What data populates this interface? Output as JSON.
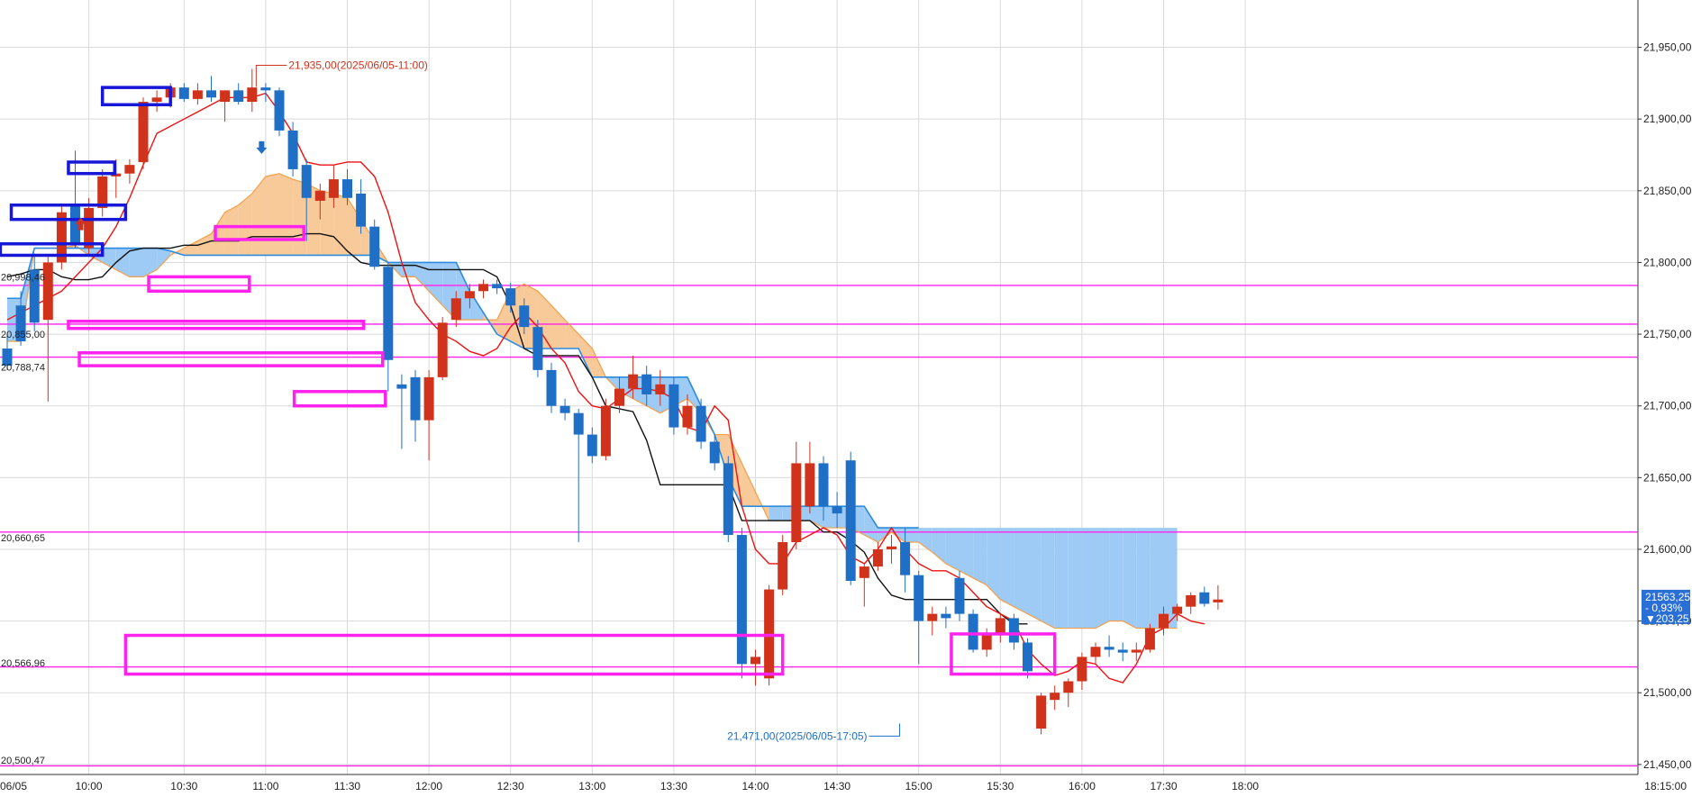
{
  "colors": {
    "grid": "#d9d9d9",
    "up": "#d1321b",
    "down": "#1f6fc6",
    "tenkan": "#ee1111",
    "kijun": "#111111",
    "span_line": "#2d8bdf",
    "cloud_blue": "#9ecbf5",
    "cloud_orange": "#f8c999",
    "span_orange_line": "#f2a04a",
    "magenta": "#ff22ee",
    "blue_box": "#1717d9",
    "price_badge": "#2a6fd6"
  },
  "chart_data": {
    "type": "candlestick",
    "title": "",
    "xlabel": "",
    "ylabel": "",
    "ylim": [
      21443,
      21983
    ],
    "y_ticks": [
      "21,450,00",
      "21,500,00",
      "21,550,00",
      "21,600,00",
      "21,650,00",
      "21,700,00",
      "21,750,00",
      "21,800,00",
      "21,850,00",
      "21,900,00",
      "21,950,00"
    ],
    "y_tick_values": [
      21450,
      21500,
      21550,
      21600,
      21650,
      21700,
      21750,
      21800,
      21850,
      21900,
      21950
    ],
    "x_ticks": [
      "06/05",
      "10:00",
      "10:30",
      "11:00",
      "11:30",
      "12:00",
      "12:30",
      "13:00",
      "13:30",
      "14:00",
      "14:30",
      "15:00",
      "15:30",
      "16:00",
      "17:30",
      "18:00",
      "18:15:00"
    ],
    "x_tick_bar_index": [
      0,
      6,
      13,
      19,
      25,
      31,
      37,
      43,
      49,
      55,
      61,
      67,
      73,
      79,
      85,
      91,
      121
    ],
    "candles": [
      {
        "o": 21740,
        "h": 21750,
        "l": 21725,
        "c": 21728
      },
      {
        "o": 21770,
        "h": 21780,
        "l": 21742,
        "c": 21745
      },
      {
        "o": 21795,
        "h": 21805,
        "l": 21752,
        "c": 21758
      },
      {
        "o": 21760,
        "h": 21805,
        "l": 21703,
        "c": 21800
      },
      {
        "o": 21800,
        "h": 21840,
        "l": 21795,
        "c": 21835
      },
      {
        "o": 21840,
        "h": 21878,
        "l": 21810,
        "c": 21812
      },
      {
        "o": 21810,
        "h": 21845,
        "l": 21806,
        "c": 21838
      },
      {
        "o": 21838,
        "h": 21865,
        "l": 21832,
        "c": 21860
      },
      {
        "o": 21860,
        "h": 21872,
        "l": 21845,
        "c": 21862
      },
      {
        "o": 21862,
        "h": 21872,
        "l": 21855,
        "c": 21868
      },
      {
        "o": 21870,
        "h": 21915,
        "l": 21865,
        "c": 21912
      },
      {
        "o": 21912,
        "h": 21920,
        "l": 21905,
        "c": 21915
      },
      {
        "o": 21915,
        "h": 21925,
        "l": 21908,
        "c": 21922
      },
      {
        "o": 21922,
        "h": 21925,
        "l": 21912,
        "c": 21914
      },
      {
        "o": 21914,
        "h": 21925,
        "l": 21910,
        "c": 21920
      },
      {
        "o": 21920,
        "h": 21930,
        "l": 21912,
        "c": 21915
      },
      {
        "o": 21912,
        "h": 21920,
        "l": 21898,
        "c": 21920
      },
      {
        "o": 21920,
        "h": 21925,
        "l": 21910,
        "c": 21912
      },
      {
        "o": 21912,
        "h": 21935,
        "l": 21905,
        "c": 21922
      },
      {
        "o": 21922,
        "h": 21925,
        "l": 21912,
        "c": 21920
      },
      {
        "o": 21920,
        "h": 21922,
        "l": 21888,
        "c": 21892
      },
      {
        "o": 21892,
        "h": 21898,
        "l": 21860,
        "c": 21865
      },
      {
        "o": 21868,
        "h": 21872,
        "l": 21815,
        "c": 21845
      },
      {
        "o": 21843,
        "h": 21855,
        "l": 21830,
        "c": 21850
      },
      {
        "o": 21845,
        "h": 21868,
        "l": 21838,
        "c": 21858
      },
      {
        "o": 21858,
        "h": 21865,
        "l": 21840,
        "c": 21845
      },
      {
        "o": 21848,
        "h": 21858,
        "l": 21820,
        "c": 21825
      },
      {
        "o": 21825,
        "h": 21830,
        "l": 21795,
        "c": 21797
      },
      {
        "o": 21797,
        "h": 21800,
        "l": 21710,
        "c": 21732
      },
      {
        "o": 21715,
        "h": 21722,
        "l": 21670,
        "c": 21712
      },
      {
        "o": 21720,
        "h": 21725,
        "l": 21675,
        "c": 21690
      },
      {
        "o": 21690,
        "h": 21725,
        "l": 21662,
        "c": 21720
      },
      {
        "o": 21720,
        "h": 21762,
        "l": 21718,
        "c": 21758
      },
      {
        "o": 21760,
        "h": 21780,
        "l": 21755,
        "c": 21775
      },
      {
        "o": 21775,
        "h": 21785,
        "l": 21768,
        "c": 21780
      },
      {
        "o": 21780,
        "h": 21788,
        "l": 21775,
        "c": 21785
      },
      {
        "o": 21785,
        "h": 21788,
        "l": 21778,
        "c": 21782
      },
      {
        "o": 21782,
        "h": 21786,
        "l": 21765,
        "c": 21770
      },
      {
        "o": 21770,
        "h": 21775,
        "l": 21750,
        "c": 21755
      },
      {
        "o": 21755,
        "h": 21760,
        "l": 21720,
        "c": 21725
      },
      {
        "o": 21725,
        "h": 21730,
        "l": 21695,
        "c": 21700
      },
      {
        "o": 21700,
        "h": 21705,
        "l": 21690,
        "c": 21695
      },
      {
        "o": 21695,
        "h": 21698,
        "l": 21605,
        "c": 21680
      },
      {
        "o": 21680,
        "h": 21685,
        "l": 21660,
        "c": 21665
      },
      {
        "o": 21665,
        "h": 21705,
        "l": 21662,
        "c": 21700
      },
      {
        "o": 21700,
        "h": 21720,
        "l": 21695,
        "c": 21712
      },
      {
        "o": 21712,
        "h": 21735,
        "l": 21705,
        "c": 21722
      },
      {
        "o": 21722,
        "h": 21728,
        "l": 21700,
        "c": 21708
      },
      {
        "o": 21708,
        "h": 21725,
        "l": 21700,
        "c": 21715
      },
      {
        "o": 21715,
        "h": 21720,
        "l": 21680,
        "c": 21685
      },
      {
        "o": 21685,
        "h": 21708,
        "l": 21680,
        "c": 21700
      },
      {
        "o": 21700,
        "h": 21705,
        "l": 21670,
        "c": 21675
      },
      {
        "o": 21675,
        "h": 21680,
        "l": 21655,
        "c": 21660
      },
      {
        "o": 21660,
        "h": 21665,
        "l": 21605,
        "c": 21610
      },
      {
        "o": 21610,
        "h": 21615,
        "l": 21510,
        "c": 21520
      },
      {
        "o": 21520,
        "h": 21530,
        "l": 21505,
        "c": 21525
      },
      {
        "o": 21510,
        "h": 21575,
        "l": 21505,
        "c": 21572
      },
      {
        "o": 21572,
        "h": 21610,
        "l": 21568,
        "c": 21605
      },
      {
        "o": 21605,
        "h": 21675,
        "l": 21600,
        "c": 21660
      },
      {
        "o": 21630,
        "h": 21675,
        "l": 21625,
        "c": 21660
      },
      {
        "o": 21660,
        "h": 21665,
        "l": 21620,
        "c": 21630
      },
      {
        "o": 21630,
        "h": 21640,
        "l": 21615,
        "c": 21625
      },
      {
        "o": 21662,
        "h": 21668,
        "l": 21575,
        "c": 21578
      },
      {
        "o": 21580,
        "h": 21590,
        "l": 21560,
        "c": 21588
      },
      {
        "o": 21588,
        "h": 21605,
        "l": 21585,
        "c": 21600
      },
      {
        "o": 21600,
        "h": 21610,
        "l": 21590,
        "c": 21602
      },
      {
        "o": 21605,
        "h": 21615,
        "l": 21570,
        "c": 21582
      },
      {
        "o": 21582,
        "h": 21585,
        "l": 21520,
        "c": 21550
      },
      {
        "o": 21550,
        "h": 21560,
        "l": 21540,
        "c": 21555
      },
      {
        "o": 21555,
        "h": 21560,
        "l": 21545,
        "c": 21552
      },
      {
        "o": 21580,
        "h": 21585,
        "l": 21550,
        "c": 21555
      },
      {
        "o": 21555,
        "h": 21558,
        "l": 21528,
        "c": 21530
      },
      {
        "o": 21530,
        "h": 21545,
        "l": 21525,
        "c": 21540
      },
      {
        "o": 21540,
        "h": 21555,
        "l": 21535,
        "c": 21552
      },
      {
        "o": 21552,
        "h": 21555,
        "l": 21530,
        "c": 21535
      },
      {
        "o": 21535,
        "h": 21538,
        "l": 21510,
        "c": 21515
      },
      {
        "o": 21475,
        "h": 21500,
        "l": 21471,
        "c": 21498
      },
      {
        "o": 21495,
        "h": 21505,
        "l": 21488,
        "c": 21500
      },
      {
        "o": 21500,
        "h": 21510,
        "l": 21490,
        "c": 21508
      },
      {
        "o": 21508,
        "h": 21528,
        "l": 21502,
        "c": 21525
      },
      {
        "o": 21525,
        "h": 21535,
        "l": 21520,
        "c": 21532
      },
      {
        "o": 21532,
        "h": 21540,
        "l": 21525,
        "c": 21530
      },
      {
        "o": 21530,
        "h": 21535,
        "l": 21522,
        "c": 21528
      },
      {
        "o": 21528,
        "h": 21535,
        "l": 21522,
        "c": 21530
      },
      {
        "o": 21530,
        "h": 21548,
        "l": 21528,
        "c": 21545
      },
      {
        "o": 21545,
        "h": 21560,
        "l": 21540,
        "c": 21555
      },
      {
        "o": 21555,
        "h": 21562,
        "l": 21550,
        "c": 21560
      },
      {
        "o": 21560,
        "h": 21570,
        "l": 21555,
        "c": 21568
      },
      {
        "o": 21570,
        "h": 21574,
        "l": 21560,
        "c": 21562
      },
      {
        "o": 21563,
        "h": 21575,
        "l": 21558,
        "c": 21565
      }
    ],
    "tenkan": [
      21760,
      21765,
      21770,
      21775,
      21780,
      21790,
      21800,
      21810,
      21825,
      21845,
      21868,
      21890,
      21895,
      21900,
      21905,
      21910,
      21915,
      21915,
      21915,
      21918,
      21905,
      21890,
      21870,
      21868,
      21868,
      21870,
      21870,
      21860,
      21835,
      21800,
      21772,
      21760,
      21750,
      21745,
      21738,
      21735,
      21740,
      21755,
      21765,
      21755,
      21740,
      21730,
      21710,
      21700,
      21698,
      21705,
      21712,
      21712,
      21710,
      21705,
      21685,
      21682,
      21700,
      21690,
      21630,
      21600,
      21590,
      21590,
      21605,
      21610,
      21615,
      21610,
      21595,
      21590,
      21600,
      21615,
      21600,
      21590,
      21585,
      21585,
      21580,
      21570,
      21560,
      21555,
      21550,
      21530,
      21520,
      21512,
      21515,
      21522,
      21520,
      21510,
      21507,
      21520,
      21540,
      21545,
      21555,
      21550,
      21548
    ],
    "kijun": [
      21790,
      21792,
      21795,
      21795,
      21790,
      21788,
      21788,
      21790,
      21800,
      21808,
      21810,
      21810,
      21810,
      21812,
      21812,
      21815,
      21815,
      21815,
      21818,
      21818,
      21818,
      21818,
      21820,
      21820,
      21818,
      21808,
      21800,
      21798,
      21798,
      21798,
      21798,
      21795,
      21795,
      21795,
      21795,
      21795,
      21790,
      21770,
      21740,
      21735,
      21735,
      21735,
      21735,
      21720,
      21700,
      21698,
      21696,
      21676,
      21645,
      21645,
      21645,
      21645,
      21645,
      21645,
      21620,
      21620,
      21620,
      21620,
      21620,
      21620,
      21612,
      21612,
      21606,
      21598,
      21580,
      21568,
      21565,
      21565,
      21565,
      21565,
      21565,
      21565,
      21565,
      21555,
      21548,
      21548
    ],
    "cloud_span1": [
      21745,
      21745,
      21810,
      21810,
      21810,
      21812,
      21805,
      21800,
      21795,
      21790,
      21790,
      21795,
      21805,
      21810,
      21815,
      21820,
      21835,
      21840,
      21848,
      21860,
      21862,
      21858,
      21855,
      21850,
      21848,
      21845,
      21830,
      21815,
      21800,
      21790,
      21790,
      21780,
      21770,
      21760,
      21760,
      21760,
      21760,
      21780,
      21785,
      21780,
      21770,
      21760,
      21750,
      21740,
      21720,
      21710,
      21705,
      21700,
      21695,
      21700,
      21705,
      21695,
      21680,
      21680,
      21660,
      21640,
      21620,
      21620,
      21620,
      21620,
      21615,
      21615,
      21615,
      21610,
      21605,
      21612,
      21605,
      21605,
      21598,
      21590,
      21585,
      21580,
      21575,
      21565,
      21560,
      21555,
      21550,
      21545,
      21545,
      21545,
      21545,
      21550,
      21550,
      21545,
      21545,
      21545,
      21545
    ],
    "cloud_span2": [
      21775,
      21775,
      21810,
      21810,
      21810,
      21810,
      21810,
      21810,
      21810,
      21810,
      21810,
      21810,
      21808,
      21805,
      21805,
      21805,
      21805,
      21805,
      21805,
      21805,
      21805,
      21805,
      21805,
      21805,
      21805,
      21805,
      21805,
      21805,
      21800,
      21800,
      21800,
      21800,
      21800,
      21800,
      21780,
      21765,
      21750,
      21745,
      21740,
      21740,
      21740,
      21740,
      21740,
      21720,
      21720,
      21720,
      21720,
      21720,
      21720,
      21720,
      21720,
      21700,
      21680,
      21650,
      21630,
      21630,
      21630,
      21630,
      21630,
      21630,
      21630,
      21630,
      21630,
      21630,
      21615,
      21615,
      21615,
      21615
    ],
    "horizontal_levels": [
      21784,
      21757,
      21734,
      21612,
      21518,
      21449
    ],
    "level_labels": [
      {
        "text": "20,998,46",
        "value": 21790
      },
      {
        "text": "20,855,00",
        "value": 21750
      },
      {
        "text": "20,788,74",
        "value": 21727
      },
      {
        "text": "20,660,65",
        "value": 21608
      },
      {
        "text": "20,566,96",
        "value": 21521
      },
      {
        "text": "20,500,47",
        "value": 21453
      }
    ],
    "annotations": {
      "high": {
        "text": "21,935,00(2025/06/05-11:00)",
        "value": 21935
      },
      "low": {
        "text": "21,471,00(2025/06/05-17:05)",
        "value": 21471
      }
    },
    "last_price": {
      "price": "21563,25",
      "change_pct": "- 0,93%",
      "change_abs": "▼203,25",
      "value": 21563
    }
  }
}
